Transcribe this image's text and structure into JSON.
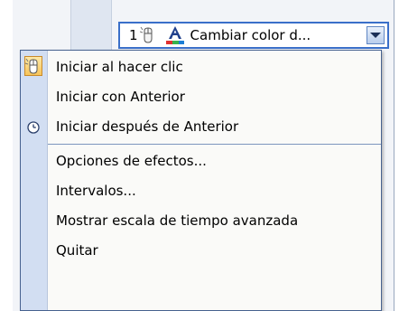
{
  "animation_item": {
    "index": "1",
    "label": "Cambiar color d...",
    "trigger_icon": "mouse-icon",
    "effect_icon": "font-color-icon",
    "dropdown_icon": "chevron-down-icon"
  },
  "menu": {
    "items": [
      {
        "label": "Iniciar al hacer clic",
        "icon": "mouse-icon",
        "selected": true
      },
      {
        "label": "Iniciar con Anterior",
        "icon": ""
      },
      {
        "label": "Iniciar después de Anterior",
        "icon": "clock-icon"
      },
      {
        "label": "Opciones de efectos...",
        "icon": ""
      },
      {
        "label": "Intervalos...",
        "icon": ""
      },
      {
        "label": "Mostrar escala de tiempo avanzada",
        "icon": ""
      },
      {
        "label": "Quitar",
        "icon": ""
      }
    ]
  },
  "colors": {
    "menu_border": "#47628f",
    "gutter": "#d2def2",
    "item_border": "#3a6fc9",
    "selected_icon_bg": "#f7c45a"
  }
}
